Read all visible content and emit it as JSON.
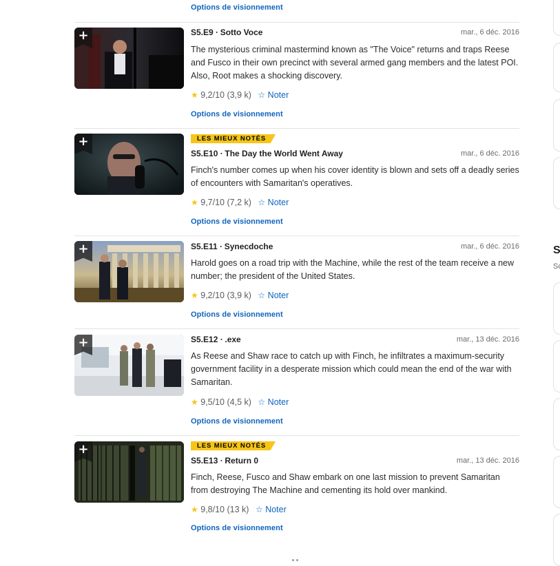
{
  "top_link": "Options de visionnement",
  "episodes": [
    {
      "badge": "",
      "title": "S5.E9 ∙ Sotto Voce",
      "date": "mar., 6 déc. 2016",
      "plot": "The mysterious criminal mastermind known as \"The Voice\" returns and traps Reese and Fusco in their own precinct with several armed gang members and the latest POI. Also, Root makes a shocking discovery.",
      "rating": "9,2/10",
      "votes": "(3,9 k)",
      "rate_label": "Noter",
      "options_label": "Options de visionnement",
      "thumb_icon": "add-to-watchlist-plus-icon"
    },
    {
      "badge": "LES MIEUX NOTÉS",
      "title": "S5.E10 ∙ The Day the World Went Away",
      "date": "mar., 6 déc. 2016",
      "plot": "Finch's number comes up when his cover identity is blown and sets off a deadly series of encounters with Samaritan's operatives.",
      "rating": "9,7/10",
      "votes": "(7,2 k)",
      "rate_label": "Noter",
      "options_label": "Options de visionnement",
      "thumb_icon": "add-to-watchlist-plus-icon"
    },
    {
      "badge": "",
      "title": "S5.E11 ∙ Synecdoche",
      "date": "mar., 6 déc. 2016",
      "plot": "Harold goes on a road trip with the Machine, while the rest of the team receive a new number; the president of the United States.",
      "rating": "9,2/10",
      "votes": "(3,9 k)",
      "rate_label": "Noter",
      "options_label": "Options de visionnement",
      "thumb_icon": "add-to-watchlist-plus-icon"
    },
    {
      "badge": "",
      "title": "S5.E12 ∙ .exe",
      "date": "mar., 13 déc. 2016",
      "plot": "As Reese and Shaw race to catch up with Finch, he infiltrates a maximum-security government facility in a desperate mission which could mean the end of the war with Samaritan.",
      "rating": "9,5/10",
      "votes": "(4,5 k)",
      "rate_label": "Noter",
      "options_label": "Options de visionnement",
      "thumb_icon": "add-to-watchlist-plus-icon"
    },
    {
      "badge": "LES MIEUX NOTÉS",
      "title": "S5.E13 ∙ Return 0",
      "date": "mar., 13 déc. 2016",
      "plot": "Finch, Reese, Fusco and Shaw embark on one last mission to prevent Samaritan from destroying The Machine and cementing its hold over mankind.",
      "rating": "9,8/10",
      "votes": "(13 k)",
      "rate_label": "Noter",
      "options_label": "Options de visionnement",
      "thumb_icon": "add-to-watchlist-plus-icon"
    }
  ],
  "right_column": {
    "heading": "S",
    "subheading": "So"
  },
  "colors": {
    "accent_blue": "#0e63be",
    "imdb_yellow": "#f5c518",
    "divider": "#e3e3e3"
  }
}
